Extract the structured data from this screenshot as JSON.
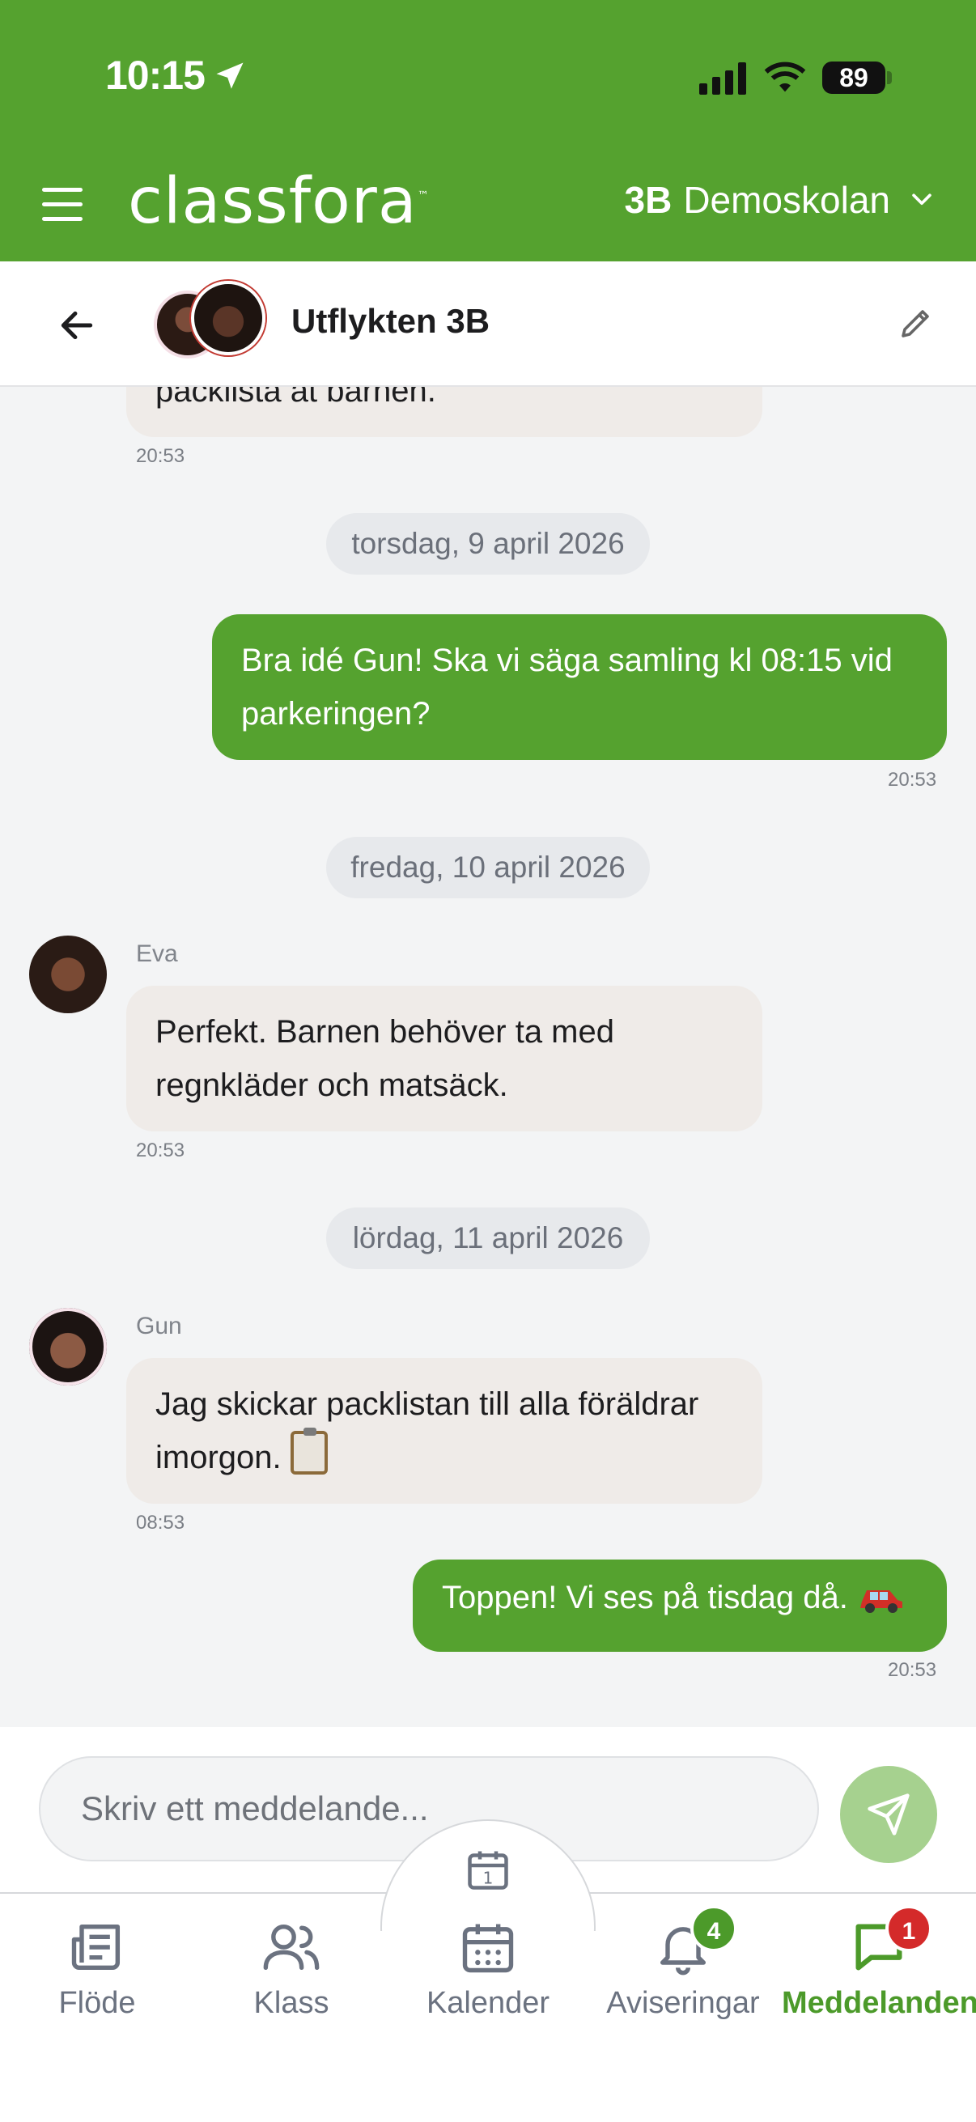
{
  "status_bar": {
    "time": "10:15",
    "battery": "89"
  },
  "app_header": {
    "logo": "classfora",
    "class_code": "3B",
    "school": "Demoskolan"
  },
  "chat": {
    "title": "Utflykten 3B"
  },
  "messages": {
    "m0": {
      "text": "packlista åt barnen.",
      "time": "20:53"
    },
    "date1": "torsdag, 9 april 2026",
    "m1": {
      "text": "Bra idé Gun! Ska vi säga samling kl 08:15 vid parkeringen?",
      "time": "20:53"
    },
    "date2": "fredag, 10 april 2026",
    "m2": {
      "sender": "Eva",
      "text": "Perfekt. Barnen behöver ta med regnkläder och matsäck.",
      "time": "20:53"
    },
    "date3": "lördag, 11 april 2026",
    "m3": {
      "sender": "Gun",
      "text": "Jag skickar packlistan till alla föräldrar imorgon.",
      "time": "08:53"
    },
    "m4": {
      "text": "Toppen! Vi ses på tisdag då.",
      "time": "20:53"
    }
  },
  "composer": {
    "placeholder": "Skriv ett meddelande..."
  },
  "nav": {
    "items": [
      {
        "label": "Flöde"
      },
      {
        "label": "Klass"
      },
      {
        "label": "Kalender"
      },
      {
        "label": "Aviseringar",
        "badge": "4"
      },
      {
        "label": "Meddelanden",
        "badge": "1"
      }
    ]
  },
  "colors": {
    "brand_green": "#55a22f",
    "badge_green": "#4c9a2a",
    "badge_red": "#d42a2a"
  }
}
